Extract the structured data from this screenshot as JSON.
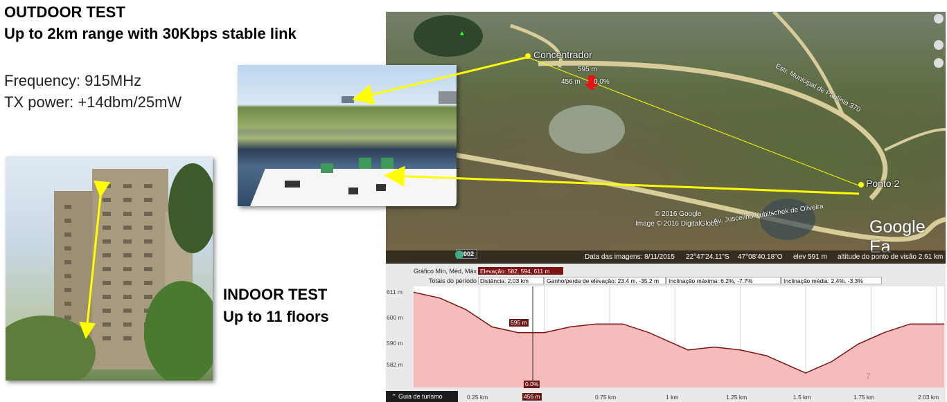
{
  "slide": {
    "title_line1": "OUTDOOR TEST",
    "title_line2": "Up to 2km range with 30Kbps stable link",
    "frequency": "Frequency: 915MHz",
    "tx_power": "TX power: +14dbm/25mW",
    "indoor_line1": "INDOOR TEST",
    "indoor_line2": "Up to 11 floors"
  },
  "map": {
    "placemark1": "Concentrador",
    "placemark2": "Ponto 2",
    "elev_595": "595 m",
    "dist_456": "456 m",
    "pct_0": "0.0%",
    "copyright1": "© 2016 Google",
    "copyright2": "Image © 2016 DigitalGlobe",
    "road1": "Av. Juscelino Kubitschek de Oliveira",
    "road2": "Estr. Municipal de Paulínia 370",
    "logo": "Google Ea",
    "year": "2002"
  },
  "statusbar": {
    "date": "Data das imagens: 8/11/2015",
    "lat": "22°47'24.11\"S",
    "lon": "47°08'40.18\"O",
    "elev": "elev  591 m",
    "alt": "altitude do ponto de visão  2.61 km"
  },
  "profile": {
    "row1_label": "Gráfico  Mín, Méd, Máx",
    "elevacao": "Elevação: 582, 594, 611 m",
    "row2_label": "Totais do período",
    "distancia": "Distância: 2.03 km",
    "ganho": "Ganho/perda de elevação: 23.4 m, -35.2 m",
    "incl_max": "Inclinação máxima: 6.2%, -7.7%",
    "incl_med": "Inclinação média: 2.4%, -3.3%",
    "y_ticks": [
      "611 m",
      "600 m",
      "590 m",
      "582 m"
    ],
    "x_ticks": [
      "0.25 km",
      "0.75 km",
      "1 km",
      "1.25 km",
      "1.5 km",
      "1.75 km",
      "2.03 km"
    ],
    "marker_elev": "595 m",
    "marker_pct": "0.0%",
    "marker_dist": "456 m",
    "guide": "Guia de turismo",
    "stray": "7"
  },
  "colors": {
    "profile_fill": "#f6bcbc",
    "profile_line": "#7a1414",
    "arrow": "#ffff00"
  }
}
